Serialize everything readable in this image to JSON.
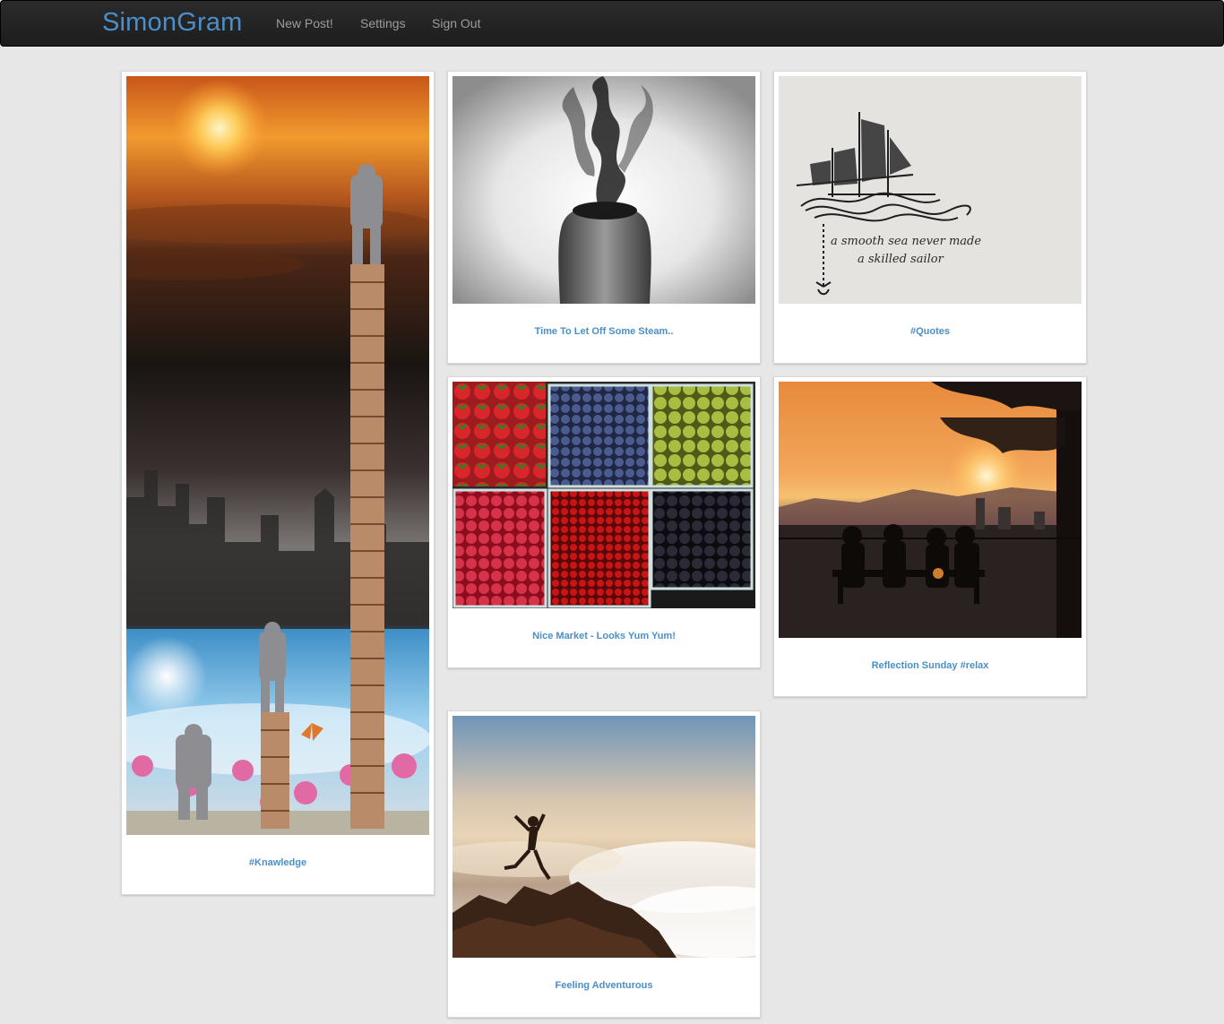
{
  "navbar": {
    "brand": "SimonGram",
    "links": [
      "New Post!",
      "Settings",
      "Sign Out"
    ]
  },
  "posts": [
    {
      "caption": "#Knawledge",
      "image": "surreal book tower above clouds at sunset"
    },
    {
      "caption": "Time To Let Off Some Steam..",
      "image": "smoke rising from back of a head"
    },
    {
      "caption": "#Quotes",
      "image": "ship sketch with quote"
    },
    {
      "caption": "Nice Market - Looks Yum Yum!",
      "image": "crates of berries"
    },
    {
      "caption": "Reflection Sunday #relax",
      "image": "people on bench watching city sunset"
    },
    {
      "caption": "Feeling Adventurous",
      "image": "person jumping on rocks above clouds"
    }
  ],
  "quote_sketch": {
    "line1": "a smooth sea never made",
    "line2": "a skilled sailor"
  },
  "colors": {
    "brand": "#4a8fc9",
    "background": "#e7e7e7",
    "navbar": "#222222"
  }
}
